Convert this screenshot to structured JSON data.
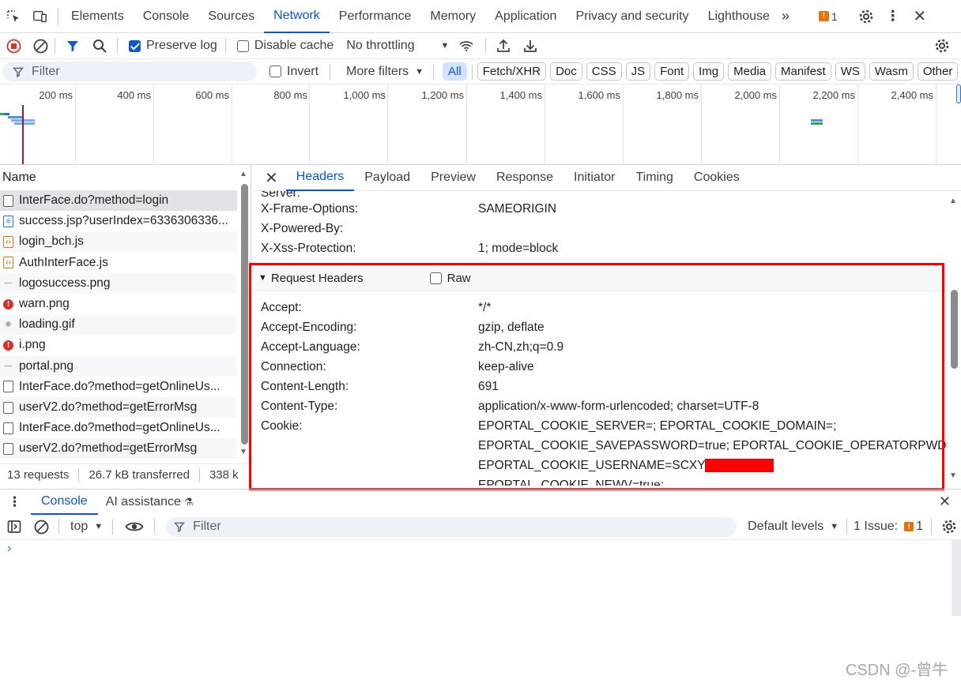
{
  "top_tabs": [
    "Elements",
    "Console",
    "Sources",
    "Network",
    "Performance",
    "Memory",
    "Application",
    "Privacy and security",
    "Lighthouse"
  ],
  "issues_count": "1",
  "toolbar": {
    "preserve_log": "Preserve log",
    "disable_cache": "Disable cache",
    "throttling": "No throttling"
  },
  "filter": {
    "placeholder": "Filter",
    "invert": "Invert",
    "more_filters": "More filters"
  },
  "type_chips": [
    "All",
    "Fetch/XHR",
    "Doc",
    "CSS",
    "JS",
    "Font",
    "Img",
    "Media",
    "Manifest",
    "WS",
    "Wasm",
    "Other"
  ],
  "timeline_ticks": [
    "200 ms",
    "400 ms",
    "600 ms",
    "800 ms",
    "1,000 ms",
    "1,200 ms",
    "1,400 ms",
    "1,600 ms",
    "1,800 ms",
    "2,000 ms",
    "2,200 ms",
    "2,400 ms"
  ],
  "list": {
    "header": "Name",
    "rows": [
      {
        "name": "InterFace.do?method=login",
        "icon": "doc-icon"
      },
      {
        "name": "success.jsp?userIndex=6336306336...",
        "icon": "document-icon"
      },
      {
        "name": "login_bch.js",
        "icon": "script-icon"
      },
      {
        "name": "AuthInterFace.js",
        "icon": "script-icon"
      },
      {
        "name": "logosuccess.png",
        "icon": "image-icon"
      },
      {
        "name": "warn.png",
        "icon": "error-icon"
      },
      {
        "name": "loading.gif",
        "icon": "spinner-icon"
      },
      {
        "name": "i.png",
        "icon": "error-icon"
      },
      {
        "name": "portal.png",
        "icon": "image-icon"
      },
      {
        "name": "InterFace.do?method=getOnlineUs...",
        "icon": "doc-icon"
      },
      {
        "name": "userV2.do?method=getErrorMsg",
        "icon": "doc-icon"
      },
      {
        "name": "InterFace.do?method=getOnlineUs...",
        "icon": "doc-icon"
      },
      {
        "name": "userV2.do?method=getErrorMsg",
        "icon": "doc-icon"
      }
    ]
  },
  "status": {
    "requests": "13 requests",
    "transferred": "26.7 kB transferred",
    "resources": "338 k"
  },
  "detail_tabs": [
    "Headers",
    "Payload",
    "Preview",
    "Response",
    "Initiator",
    "Timing",
    "Cookies"
  ],
  "response_headers_partial": [
    {
      "name": "Server:",
      "value": ""
    },
    {
      "name": "X-Frame-Options:",
      "value": "SAMEORIGIN"
    },
    {
      "name": "X-Powered-By:",
      "value": ""
    },
    {
      "name": "X-Xss-Protection:",
      "value": "1; mode=block"
    }
  ],
  "request_headers": {
    "title": "Request Headers",
    "raw_label": "Raw",
    "rows": [
      {
        "name": "Accept:",
        "value": "*/*"
      },
      {
        "name": "Accept-Encoding:",
        "value": "gzip, deflate"
      },
      {
        "name": "Accept-Language:",
        "value": "zh-CN,zh;q=0.9"
      },
      {
        "name": "Connection:",
        "value": "keep-alive"
      },
      {
        "name": "Content-Length:",
        "value": "691"
      },
      {
        "name": "Content-Type:",
        "value": "application/x-www-form-urlencoded; charset=UTF-8"
      },
      {
        "name": "Cookie:",
        "value": "EPORTAL_COOKIE_SERVER=; EPORTAL_COOKIE_DOMAIN=;"
      }
    ],
    "cookie_lines": [
      "EPORTAL_COOKIE_SAVEPASSWORD=true; EPORTAL_COOKIE_OPERATORPWD=;",
      "EPORTAL_COOKIE_USERNAME=SCXY15",
      "EPORTAL_COOKIE_NEWV=true;"
    ]
  },
  "drawer": {
    "console_tab": "Console",
    "ai_tab": "AI assistance"
  },
  "console_toolbar": {
    "context": "top",
    "filter_placeholder": "Filter",
    "levels": "Default levels",
    "issues_label": "1 Issue:",
    "issues_count": "1"
  },
  "watermark": "CSDN @-曾牛",
  "colors": {
    "accent": "#0b57d0",
    "highlight_box": "#ff0000",
    "redaction": "#ff0000",
    "record": "#d93025"
  }
}
